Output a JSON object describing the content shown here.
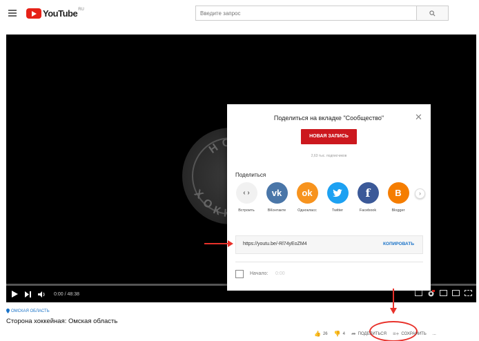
{
  "header": {
    "logo_text": "YouTube",
    "logo_country": "RU",
    "search_placeholder": "Введите запрос"
  },
  "player": {
    "time": "0:00 / 48:38",
    "emblem_letters": [
      "Н",
      "О",
      "С",
      "Х",
      "О",
      "К",
      "К",
      "Е",
      "Й"
    ]
  },
  "share_dialog": {
    "title": "Поделиться на вкладке \"Сообщество\"",
    "new_post_label": "НОВАЯ ЗАПИСЬ",
    "subscribers": "2,63 тыс. подписчиков",
    "share_heading": "Поделиться",
    "targets": [
      {
        "label": "Встроить",
        "icon": "embed-icon",
        "color": "#f1f1f1"
      },
      {
        "label": "ВКонтакте",
        "icon": "vk-icon",
        "color": "#4a76a8"
      },
      {
        "label": "Однокласс",
        "icon": "odnoklassniki-icon",
        "color": "#f7931e"
      },
      {
        "label": "Twitter",
        "icon": "twitter-icon",
        "color": "#1da1f2"
      },
      {
        "label": "Facebook",
        "icon": "facebook-icon",
        "color": "#3b5998"
      },
      {
        "label": "Blogger",
        "icon": "blogger-icon",
        "color": "#f57d00"
      }
    ],
    "link": "https://youtu.be/-Rl74yEoZM4",
    "copy_label": "КОПИРОВАТЬ",
    "start_label": "Начало:",
    "start_time": "0:00"
  },
  "video_info": {
    "location": "ОМСКАЯ ОБЛАСТЬ",
    "title": "Сторона хоккейная: Омская область",
    "likes": "26",
    "dislikes": "4",
    "share_label": "ПОДЕЛИТЬСЯ",
    "save_label": "СОХРАНИТЬ",
    "more_label": "..."
  },
  "colors": {
    "brand_red": "#e62117",
    "annotation_red": "#e8312a",
    "link_blue": "#1a73c8"
  }
}
